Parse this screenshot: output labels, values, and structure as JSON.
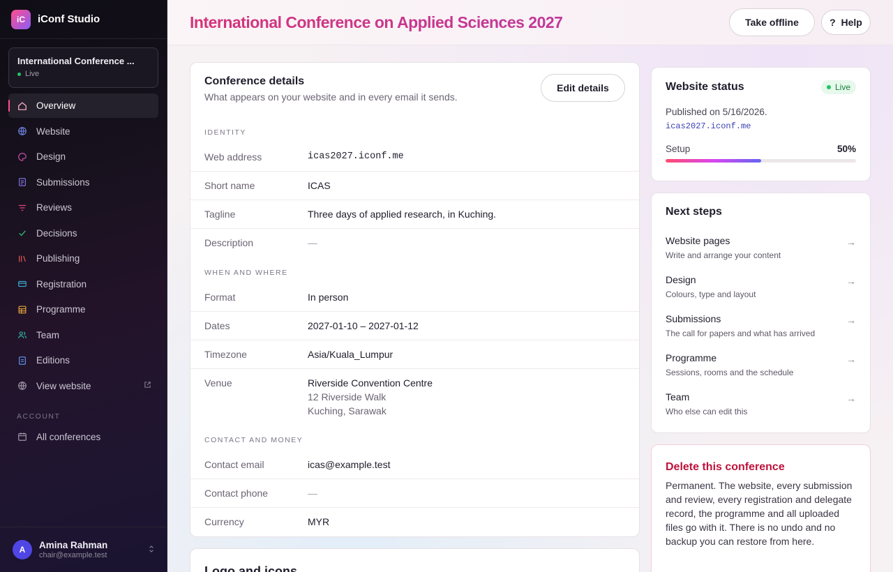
{
  "app": {
    "logo_text": "iC",
    "name": "iConf Studio"
  },
  "sidebar": {
    "conference": {
      "title": "International Conference ...",
      "status": "Live"
    },
    "items": [
      {
        "label": "Overview",
        "icon": "home-icon"
      },
      {
        "label": "Website",
        "icon": "globe-icon"
      },
      {
        "label": "Design",
        "icon": "palette-icon"
      },
      {
        "label": "Submissions",
        "icon": "document-icon"
      },
      {
        "label": "Reviews",
        "icon": "filter-icon"
      },
      {
        "label": "Decisions",
        "icon": "check-icon"
      },
      {
        "label": "Publishing",
        "icon": "books-icon"
      },
      {
        "label": "Registration",
        "icon": "ticket-icon"
      },
      {
        "label": "Programme",
        "icon": "grid-icon"
      },
      {
        "label": "Team",
        "icon": "people-icon"
      },
      {
        "label": "Editions",
        "icon": "file-icon"
      },
      {
        "label": "View website",
        "icon": "globe-icon"
      }
    ],
    "account_label": "ACCOUNT",
    "account_items": [
      {
        "label": "All conferences",
        "icon": "calendar-icon"
      }
    ],
    "user": {
      "initial": "A",
      "name": "Amina Rahman",
      "email": "chair@example.test"
    }
  },
  "header": {
    "title": "International Conference on Applied Sciences 2027",
    "offline_label": "Take offline",
    "help_label": "Help",
    "help_icon": "?"
  },
  "details": {
    "title": "Conference details",
    "subtitle": "What appears on your website and in every email it sends.",
    "edit_label": "Edit details",
    "groups": {
      "identity": "IDENTITY",
      "when_where": "WHEN AND WHERE",
      "contact_money": "CONTACT AND MONEY"
    },
    "rows": {
      "web_address": {
        "label": "Web address",
        "value": "icas2027.iconf.me"
      },
      "short_name": {
        "label": "Short name",
        "value": "ICAS"
      },
      "tagline": {
        "label": "Tagline",
        "value": "Three days of applied research, in Kuching."
      },
      "description": {
        "label": "Description",
        "value": "—"
      },
      "format": {
        "label": "Format",
        "value": "In person"
      },
      "dates": {
        "label": "Dates",
        "value": "2027-01-10 – 2027-01-12"
      },
      "timezone": {
        "label": "Timezone",
        "value": "Asia/Kuala_Lumpur"
      },
      "venue": {
        "label": "Venue",
        "name": "Riverside Convention Centre",
        "line1": "12 Riverside Walk",
        "line2": "Kuching, Sarawak"
      },
      "contact_email": {
        "label": "Contact email",
        "value": "icas@example.test"
      },
      "contact_phone": {
        "label": "Contact phone",
        "value": "—"
      },
      "currency": {
        "label": "Currency",
        "value": "MYR"
      }
    }
  },
  "logo_card": {
    "title": "Logo and icons"
  },
  "status": {
    "title": "Website status",
    "badge": "Live",
    "published": "Published on 5/16/2026.",
    "url": "icas2027.iconf.me",
    "setup_label": "Setup",
    "setup_value": "50%",
    "setup_fraction": 0.5
  },
  "next_steps": {
    "title": "Next steps",
    "items": [
      {
        "title": "Website pages",
        "subtitle": "Write and arrange your content"
      },
      {
        "title": "Design",
        "subtitle": "Colours, type and layout"
      },
      {
        "title": "Submissions",
        "subtitle": "The call for papers and what has arrived"
      },
      {
        "title": "Programme",
        "subtitle": "Sessions, rooms and the schedule"
      },
      {
        "title": "Team",
        "subtitle": "Who else can edit this"
      }
    ]
  },
  "danger": {
    "title": "Delete this conference",
    "text": "Permanent. The website, every submission and review, every registration and delegate record, the programme and all uploaded files go with it. There is no undo and no backup you can restore from here."
  },
  "colors": {
    "accent": "#d6337a",
    "live": "#22c55e",
    "danger": "#be123c"
  }
}
